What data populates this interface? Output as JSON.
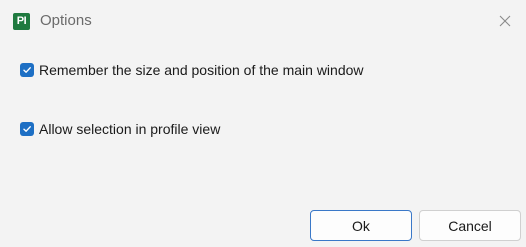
{
  "window": {
    "title": "Options",
    "app_icon_text": "PI",
    "app_icon_color": "#1f7a3f"
  },
  "options": [
    {
      "label": "Remember the size and position of the main window",
      "checked": true
    },
    {
      "label": "Allow selection in profile view",
      "checked": true
    }
  ],
  "buttons": {
    "ok_label": "Ok",
    "cancel_label": "Cancel"
  },
  "colors": {
    "accent": "#1d6fc4",
    "ok_border": "#3a78c8",
    "background": "#f3f3f3"
  },
  "icons": {
    "close": "close-icon",
    "check": "checkmark-icon",
    "app": "app-logo-icon"
  }
}
